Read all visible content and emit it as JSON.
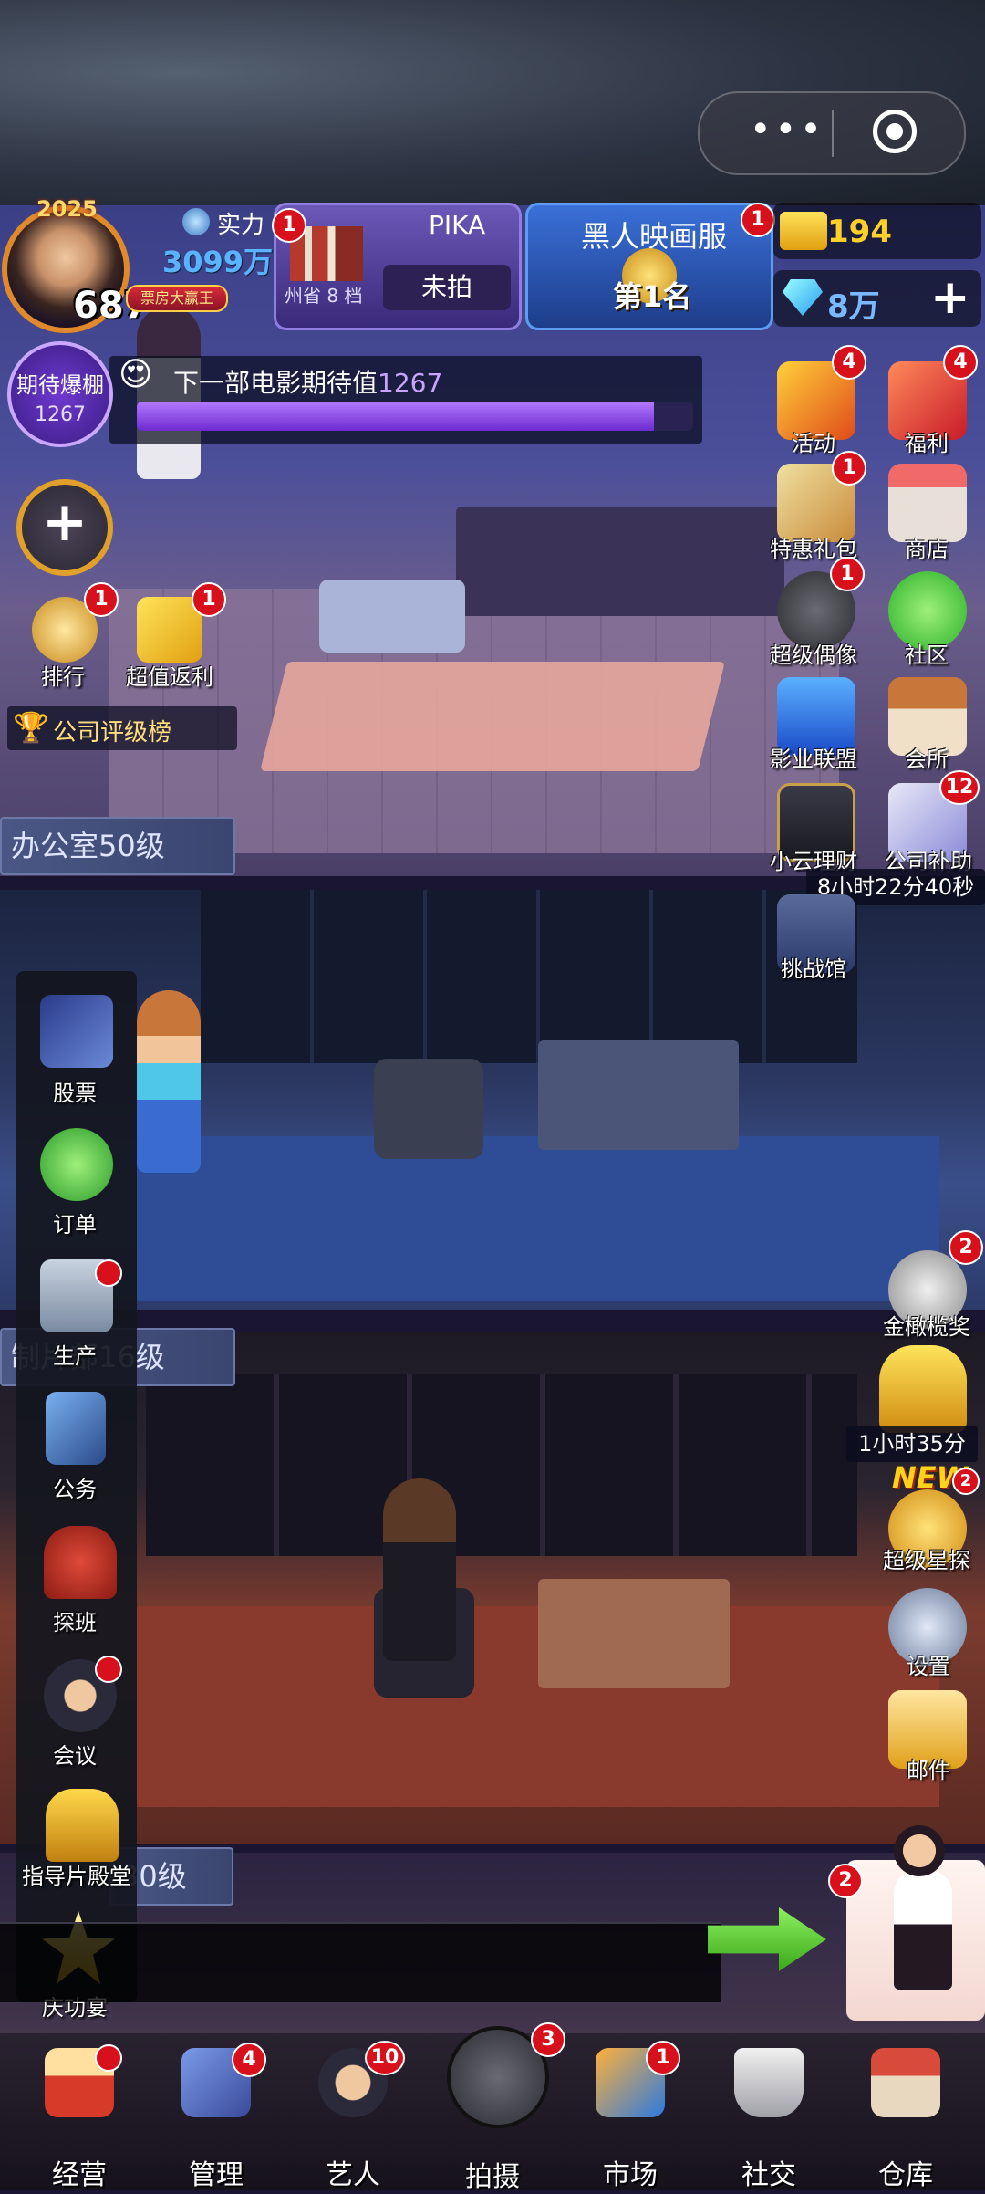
{
  "top_bar": {
    "player": {
      "year": "2025",
      "level": "687",
      "title": "票房大赢王"
    },
    "power": {
      "label": "实力",
      "value": "3099万"
    },
    "film": {
      "name": "PIKA",
      "city_rank": "州省 8 档",
      "status": "未拍",
      "badge": "1"
    },
    "rank": {
      "title": "黑人映画服",
      "value": "第1名",
      "badge": "1"
    },
    "ticket_value": "194",
    "gem_value": "8万",
    "gem_plus": "+",
    "capsule_dots": "•••"
  },
  "expectation": {
    "label": "期待爆棚",
    "number": "1267",
    "text": "下一部电影期待值",
    "value": "1267",
    "progress": 0.93
  },
  "left_buttons": {
    "add": "+",
    "rank": {
      "label": "排行",
      "badge": "1"
    },
    "rebate": {
      "label": "超值返利",
      "badge": "1"
    },
    "company_rank": "公司评级榜"
  },
  "floors": {
    "office": "办公室50级",
    "production": "制片部16级",
    "third": "30级"
  },
  "side_menu": [
    {
      "label": "股票"
    },
    {
      "label": "订单"
    },
    {
      "label": "生产"
    },
    {
      "label": "公务"
    },
    {
      "label": "探班"
    },
    {
      "label": "会议"
    },
    {
      "label": "指导片殿堂"
    },
    {
      "label": "庆功宴"
    }
  ],
  "right_menu": {
    "activity": {
      "label": "活动",
      "badge": "4"
    },
    "welfare": {
      "label": "福利",
      "badge": "4"
    },
    "gift": {
      "label": "特惠礼包",
      "badge": "1"
    },
    "shop": {
      "label": "商店"
    },
    "idol": {
      "label": "超级偶像",
      "badge": "1"
    },
    "community": {
      "label": "社区"
    },
    "alliance": {
      "label": "影业联盟"
    },
    "club": {
      "label": "会所"
    },
    "finance": {
      "label": "小云理财"
    },
    "subsidy": {
      "label": "公司补助",
      "badge": "12"
    },
    "subsidy_timer": "8小时22分40秒",
    "challenge": {
      "label": "挑战馆"
    },
    "olive": {
      "label": "金橄榄奖",
      "badge": "2"
    },
    "trophy_timer": "1小时35分",
    "scout": {
      "label": "超级星探",
      "badge": "2",
      "tag": "NEW"
    },
    "settings": {
      "label": "设置"
    },
    "mail": {
      "label": "邮件"
    }
  },
  "advisor_badge": "2",
  "bottom_nav": [
    {
      "label": "经营",
      "badge": ""
    },
    {
      "label": "管理",
      "badge": "4"
    },
    {
      "label": "艺人",
      "badge": "10"
    },
    {
      "label": "拍摄",
      "badge": "3"
    },
    {
      "label": "市场",
      "badge": "1"
    },
    {
      "label": "社交",
      "badge": ""
    },
    {
      "label": "仓库",
      "badge": ""
    }
  ]
}
